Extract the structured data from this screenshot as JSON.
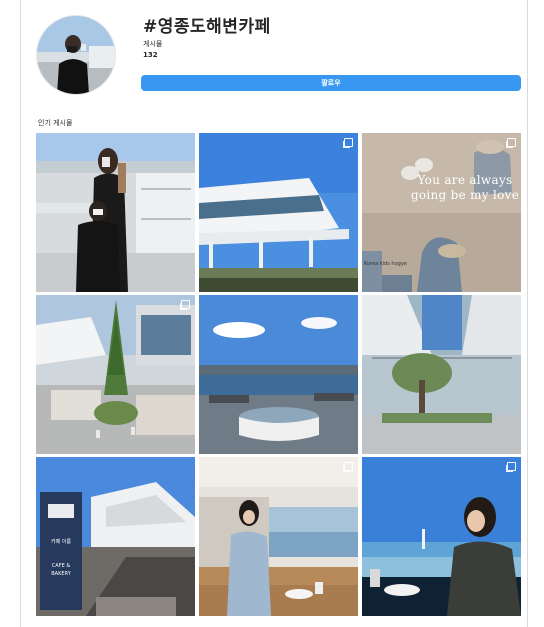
{
  "profile": {
    "title": "#영종도해변카페",
    "posts_label": "게시물",
    "posts_count": "132",
    "follow_label": "팔로우"
  },
  "section": {
    "top_posts_label": "인기 게시물"
  },
  "tiles": {
    "t3": {
      "overlay": "You are always going be my love",
      "caption": "Korea kids hogye"
    },
    "t7": {
      "sign_text": "카페 이름",
      "sign_sub": "CAFE & BAKERY"
    }
  },
  "colors": {
    "accent": "#3897f0",
    "border": "#dbdbdb"
  },
  "icons": [
    "multiple-photos-icon"
  ]
}
